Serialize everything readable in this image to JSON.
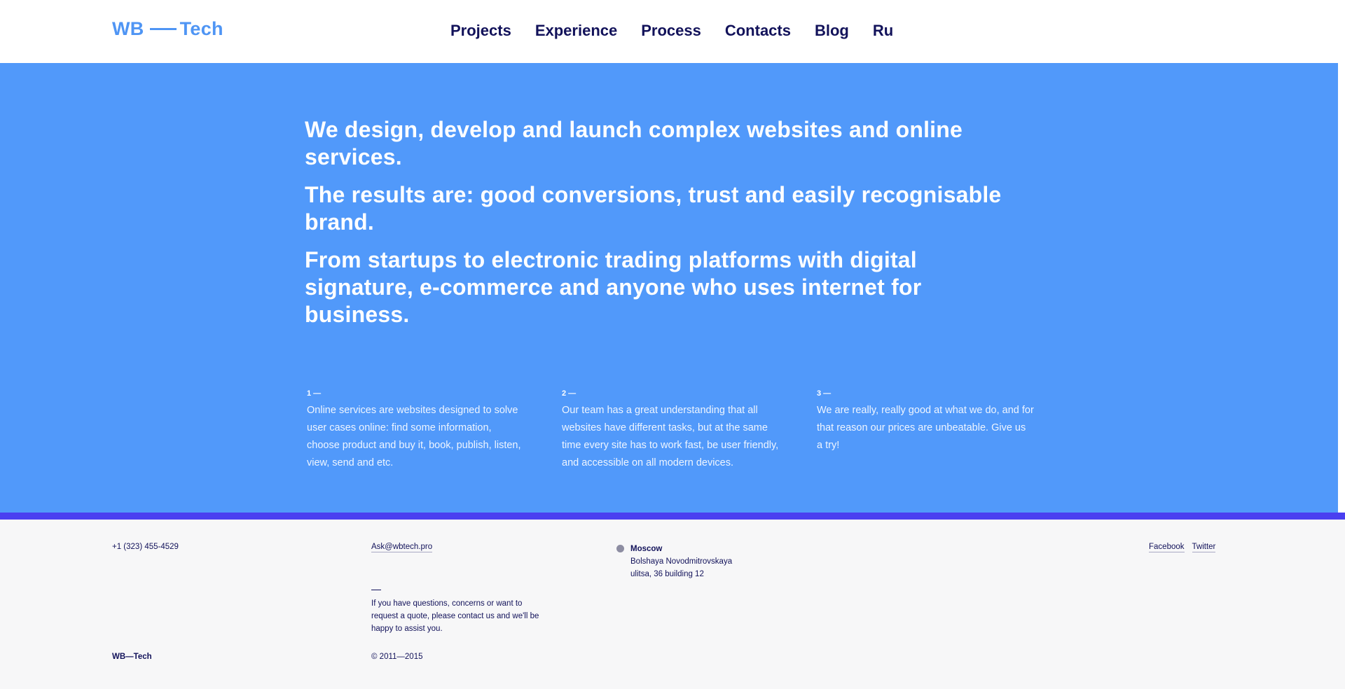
{
  "header": {
    "logo_left": "WB",
    "logo_right": "Tech",
    "nav": [
      "Projects",
      "Experience",
      "Process",
      "Contacts",
      "Blog",
      "Ru"
    ]
  },
  "hero": {
    "paragraphs": [
      "We design, develop and launch complex websites and online services.",
      "The results are: good conversions, trust and easily recognisable brand.",
      "From startups to electronic trading platforms with digital signature, e-commerce and anyone who uses internet for business."
    ],
    "features": [
      {
        "num": "1 —",
        "text": "Online services are websites designed to solve user cases online: find some information, choose product and buy it, book, publish, listen, view, send and etc."
      },
      {
        "num": "2 —",
        "text": "Our team has a great understanding that all websites have different tasks, but at the same time every site has to work fast, be user friendly, and accessible on all modern devices."
      },
      {
        "num": "3 —",
        "text": "We are really, really good at what we do, and for that reason our prices are unbeatable. Give us a try!"
      }
    ]
  },
  "footer": {
    "phone": "+1 (323) 455-4529",
    "email": "Ask@wbtech.pro",
    "city": "Moscow",
    "address_line1": "Bolshaya Novodmitrovskaya",
    "address_line2": "ulitsa, 36 building 12",
    "social": [
      "Facebook",
      "Twitter"
    ],
    "note": "If you have questions, concerns or want to request a quote, please contact us and we'll be happy to assist you.",
    "brand": "WB—Tech",
    "copyright": "© 2011—2015"
  },
  "colors": {
    "accent": "#5199fa",
    "band": "#4a3ff0",
    "nav_text": "#12125a",
    "footer_bg": "#f7f7f8"
  }
}
